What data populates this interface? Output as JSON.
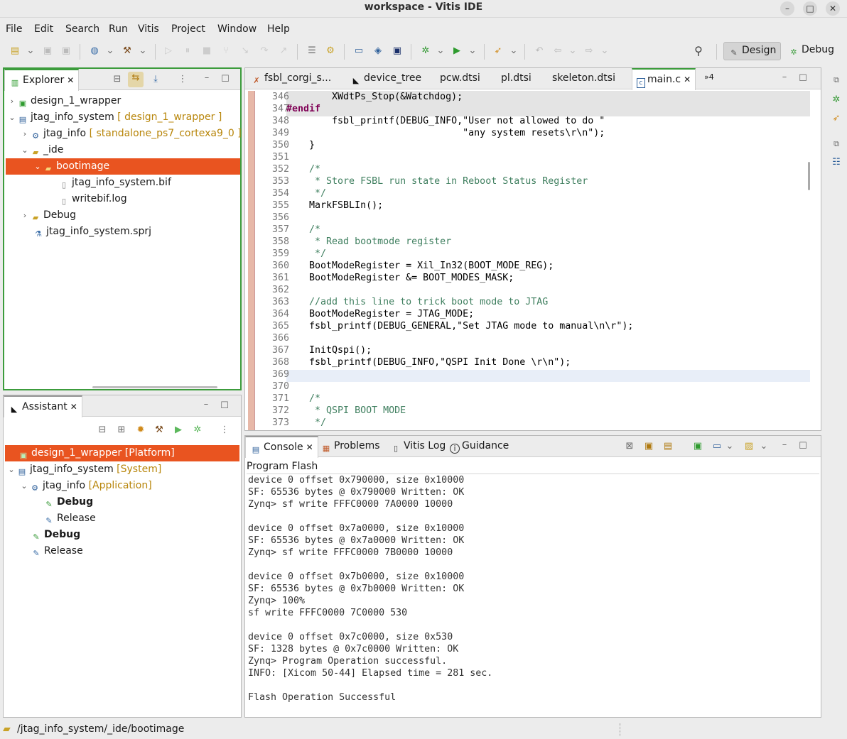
{
  "window": {
    "title": "workspace - Vitis IDE"
  },
  "menu": [
    "File",
    "Edit",
    "Search",
    "Run",
    "Vitis",
    "Project",
    "Window",
    "Help"
  ],
  "perspectives": {
    "design": "Design",
    "debug": "Debug"
  },
  "explorer": {
    "tab": "Explorer",
    "items": [
      {
        "label": "design_1_wrapper",
        "deco": ""
      },
      {
        "label": "jtag_info_system",
        "deco": "[ design_1_wrapper ]"
      },
      {
        "label": "jtag_info",
        "deco": "[ standalone_ps7_cortexa9_0 ]"
      },
      {
        "label": "_ide",
        "deco": ""
      },
      {
        "label": "bootimage",
        "deco": ""
      },
      {
        "label": "jtag_info_system.bif",
        "deco": ""
      },
      {
        "label": "writebif.log",
        "deco": ""
      },
      {
        "label": "Debug",
        "deco": ""
      },
      {
        "label": "jtag_info_system.sprj",
        "deco": ""
      }
    ]
  },
  "assistant": {
    "tab": "Assistant",
    "items": [
      {
        "label": "design_1_wrapper",
        "deco": "[Platform]"
      },
      {
        "label": "jtag_info_system",
        "deco": "[System]"
      },
      {
        "label": "jtag_info",
        "deco": "[Application]"
      },
      {
        "label": "Debug",
        "deco": ""
      },
      {
        "label": "Release",
        "deco": ""
      },
      {
        "label": "Debug",
        "deco": ""
      },
      {
        "label": "Release",
        "deco": ""
      }
    ]
  },
  "editor_tabs": [
    "fsbl_corgi_s...",
    "device_tree",
    "pcw.dtsi",
    "pl.dtsi",
    "skeleton.dtsi",
    "main.c",
    "»4"
  ],
  "code_lines": [
    {
      "n": "346",
      "t": "        XWdtPs_Stop(&Watchdog);",
      "cls": ""
    },
    {
      "n": "347",
      "t": "#endif",
      "cls": "kw"
    },
    {
      "n": "348",
      "t": "        fsbl_printf(DEBUG_INFO,\"User not allowed to do \"",
      "cls": ""
    },
    {
      "n": "349",
      "t": "                               \"any system resets\\r\\n\");",
      "cls": ""
    },
    {
      "n": "350",
      "t": "    }",
      "cls": ""
    },
    {
      "n": "351",
      "t": "",
      "cls": ""
    },
    {
      "n": "352",
      "t": "    /*",
      "cls": "cm"
    },
    {
      "n": "353",
      "t": "     * Store FSBL run state in Reboot Status Register",
      "cls": "cm"
    },
    {
      "n": "354",
      "t": "     */",
      "cls": "cm"
    },
    {
      "n": "355",
      "t": "    MarkFSBLIn();",
      "cls": ""
    },
    {
      "n": "356",
      "t": "",
      "cls": ""
    },
    {
      "n": "357",
      "t": "    /*",
      "cls": "cm"
    },
    {
      "n": "358",
      "t": "     * Read bootmode register",
      "cls": "cm"
    },
    {
      "n": "359",
      "t": "     */",
      "cls": "cm"
    },
    {
      "n": "360",
      "t": "    BootModeRegister = Xil_In32(BOOT_MODE_REG);",
      "cls": ""
    },
    {
      "n": "361",
      "t": "    BootModeRegister &= BOOT_MODES_MASK;",
      "cls": ""
    },
    {
      "n": "362",
      "t": "",
      "cls": ""
    },
    {
      "n": "363",
      "t": "    //add this line to trick boot mode to JTAG",
      "cls": "cm"
    },
    {
      "n": "364",
      "t": "    BootModeRegister = JTAG_MODE;",
      "cls": ""
    },
    {
      "n": "365",
      "t": "    fsbl_printf(DEBUG_GENERAL,\"Set JTAG mode to manual\\n\\r\");",
      "cls": ""
    },
    {
      "n": "366",
      "t": "",
      "cls": ""
    },
    {
      "n": "367",
      "t": "    InitQspi();",
      "cls": ""
    },
    {
      "n": "368",
      "t": "    fsbl_printf(DEBUG_INFO,\"QSPI Init Done \\r\\n\");",
      "cls": ""
    },
    {
      "n": "369",
      "t": "",
      "cls": ""
    },
    {
      "n": "370",
      "t": "",
      "cls": ""
    },
    {
      "n": "371",
      "t": "    /*",
      "cls": "cm"
    },
    {
      "n": "372",
      "t": "     * QSPI BOOT MODE",
      "cls": "cm"
    },
    {
      "n": "373",
      "t": "     */",
      "cls": "cm"
    }
  ],
  "bottom_tabs": [
    "Console",
    "Problems",
    "Vitis Log",
    "Guidance"
  ],
  "console": {
    "title": "Program Flash",
    "lines": [
      "device 0 offset 0x790000, size 0x10000",
      "SF: 65536 bytes @ 0x790000 Written: OK",
      "Zynq> sf write FFFC0000 7A0000 10000",
      "",
      "device 0 offset 0x7a0000, size 0x10000",
      "SF: 65536 bytes @ 0x7a0000 Written: OK",
      "Zynq> sf write FFFC0000 7B0000 10000",
      "",
      "device 0 offset 0x7b0000, size 0x10000",
      "SF: 65536 bytes @ 0x7b0000 Written: OK",
      "Zynq> 100%",
      "sf write FFFC0000 7C0000 530",
      "",
      "device 0 offset 0x7c0000, size 0x530",
      "SF: 1328 bytes @ 0x7c0000 Written: OK",
      "Zynq> Program Operation successful.",
      "INFO: [Xicom 50-44] Elapsed time = 281 sec.",
      "",
      "Flash Operation Successful"
    ]
  },
  "status": {
    "path": "/jtag_info_system/_ide/bootimage"
  },
  "colors": {
    "accent": "#3c9c3c",
    "selection": "#e95420"
  }
}
